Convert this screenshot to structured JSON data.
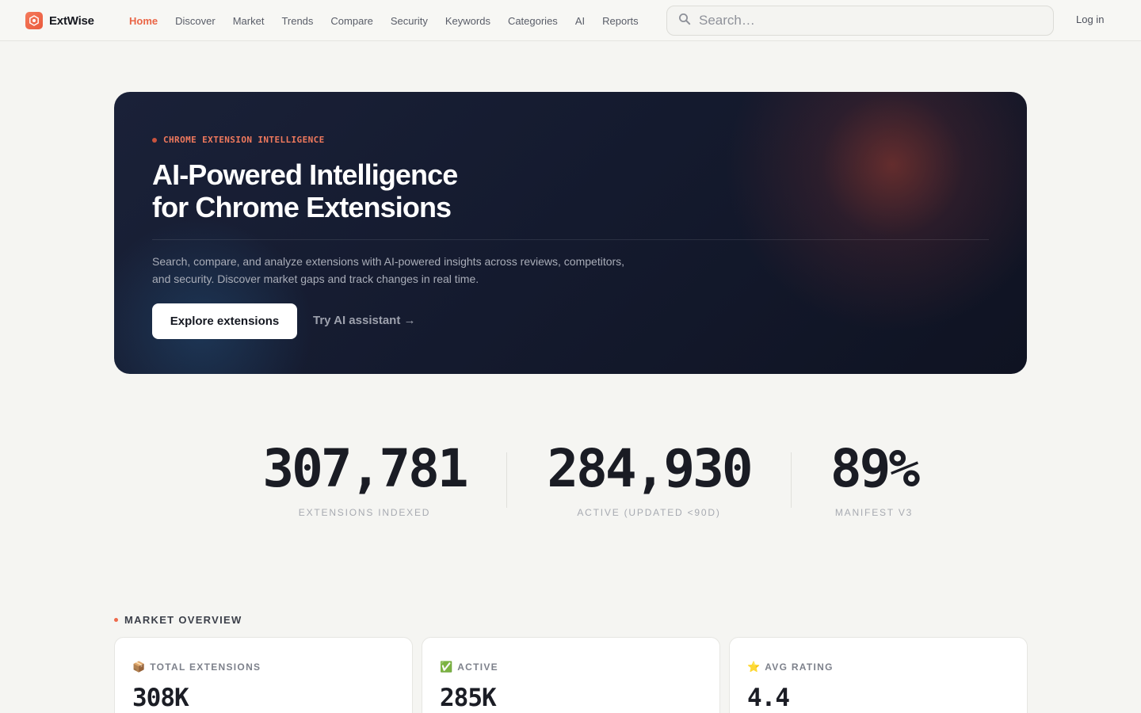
{
  "app": {
    "name": "ExtWise"
  },
  "nav": {
    "links": [
      "Home",
      "Discover",
      "Market",
      "Trends",
      "Compare",
      "Security",
      "Keywords",
      "Categories",
      "AI",
      "Reports"
    ],
    "active": "Home",
    "search_placeholder": "Search…",
    "login_label": "Log in"
  },
  "hero": {
    "eyebrow": "CHROME EXTENSION INTELLIGENCE",
    "title_line1": "AI-Powered Intelligence",
    "title_line2": "for Chrome Extensions",
    "desc_line1": "Search, compare, and analyze extensions with AI-powered insights across reviews, competitors,",
    "desc_line2": "and security. Discover market gaps and track changes in real time.",
    "primary_cta": "Explore extensions",
    "secondary_cta": "Try AI assistant →"
  },
  "stats": [
    {
      "value": "307,781",
      "label": "EXTENSIONS INDEXED"
    },
    {
      "value": "284,930",
      "label": "ACTIVE (UPDATED <90D)"
    },
    {
      "value": "89%",
      "label": "MANIFEST V3"
    }
  ],
  "market_overview": {
    "title": "MARKET OVERVIEW",
    "cards": [
      {
        "icon": "package-icon",
        "emoji": "📦",
        "label": "TOTAL EXTENSIONS",
        "value": "308K"
      },
      {
        "icon": "check-icon",
        "emoji": "✅",
        "label": "ACTIVE",
        "value": "285K"
      },
      {
        "icon": "star-icon",
        "emoji": "⭐",
        "label": "AVG RATING",
        "value": "4.4"
      }
    ]
  },
  "colors": {
    "accent": "#ea6546",
    "hero_bg": "#141a2e",
    "page_bg": "#f5f5f2"
  }
}
